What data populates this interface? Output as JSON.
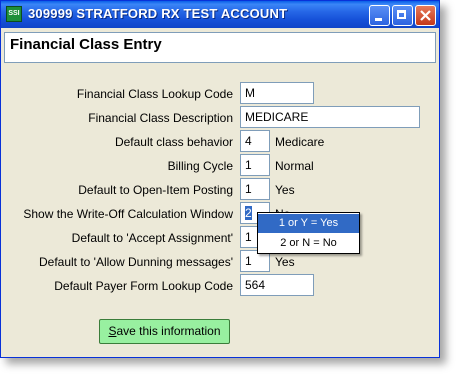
{
  "window": {
    "title": "309999 STRATFORD RX TEST ACCOUNT",
    "icon_text": "SSI"
  },
  "header": {
    "title": "Financial Class Entry"
  },
  "form": {
    "lookup_code": {
      "label": "Financial Class Lookup Code",
      "value": "M"
    },
    "description": {
      "label": "Financial Class Description",
      "value": "MEDICARE"
    },
    "default_behavior": {
      "label": "Default class behavior",
      "value": "4",
      "suffix": "Medicare"
    },
    "billing_cycle": {
      "label": "Billing Cycle",
      "value": "1",
      "suffix": "Normal"
    },
    "open_item_posting": {
      "label": "Default to Open-Item Posting",
      "value": "1",
      "suffix": "Yes"
    },
    "write_off_window": {
      "label": "Show the Write-Off Calculation Window",
      "value": "2",
      "suffix": "No"
    },
    "accept_assignment": {
      "label": "Default to 'Accept Assignment'",
      "value": "1"
    },
    "allow_dunning": {
      "label": "Default to 'Allow Dunning messages'",
      "value": "1",
      "suffix": "Yes"
    },
    "payer_form_code": {
      "label": "Default Payer Form Lookup Code",
      "value": "564"
    }
  },
  "dropdown": {
    "options": [
      "1 or Y = Yes",
      "2 or N = No"
    ],
    "highlighted_index": 0
  },
  "save_button": {
    "label_underlined": "S",
    "label_rest": "ave this information"
  },
  "colors": {
    "titlebar": "#2566e6",
    "window_bg": "#ece9d8",
    "save_button_bg": "#98f0a0",
    "dropdown_highlight": "#316ac5"
  }
}
